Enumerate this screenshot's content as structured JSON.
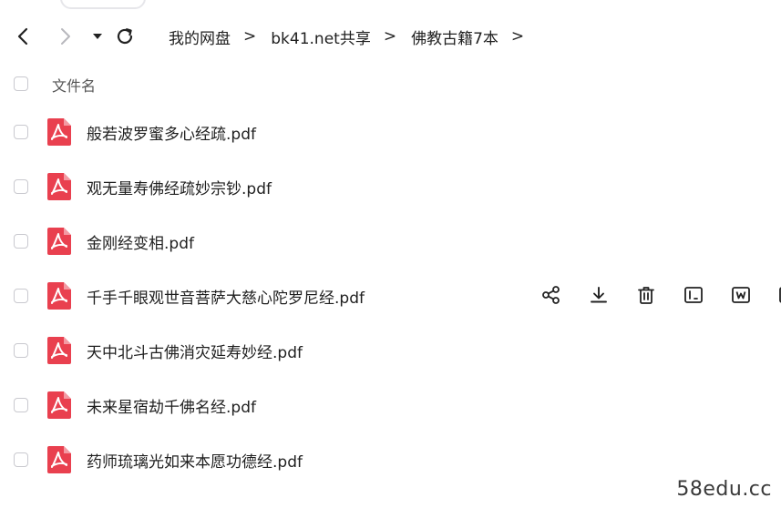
{
  "toolbar": {
    "icons": [
      "back-arrow-icon",
      "forward-arrow-icon",
      "caret-down-icon",
      "refresh-icon"
    ]
  },
  "breadcrumb": {
    "items": [
      "我的网盘",
      "bk41.net共享",
      "佛教古籍7本"
    ],
    "separator": ">"
  },
  "file_list": {
    "header": {
      "name_column": "文件名"
    },
    "files": [
      {
        "name": "般若波罗蜜多心经疏.pdf",
        "type": "pdf"
      },
      {
        "name": "观无量寿佛经疏妙宗钞.pdf",
        "type": "pdf"
      },
      {
        "name": "金刚经变相.pdf",
        "type": "pdf"
      },
      {
        "name": "千手千眼观世音菩萨大慈心陀罗尼经.pdf",
        "type": "pdf",
        "hovered": true
      },
      {
        "name": "天中北斗古佛消灾延寿妙经.pdf",
        "type": "pdf"
      },
      {
        "name": "未来星宿劫千佛名经.pdf",
        "type": "pdf"
      },
      {
        "name": "药师琉璃光如来本愿功德经.pdf",
        "type": "pdf"
      }
    ],
    "row_actions": [
      "share-icon",
      "download-icon",
      "delete-icon",
      "rename-icon",
      "word-convert-icon",
      "more-icon"
    ]
  },
  "watermark": {
    "text": "58edu.cc"
  },
  "colors": {
    "pdf_red": "#e9404f",
    "text": "#1f1f1f",
    "checkbox_border": "#c9c9cf"
  }
}
